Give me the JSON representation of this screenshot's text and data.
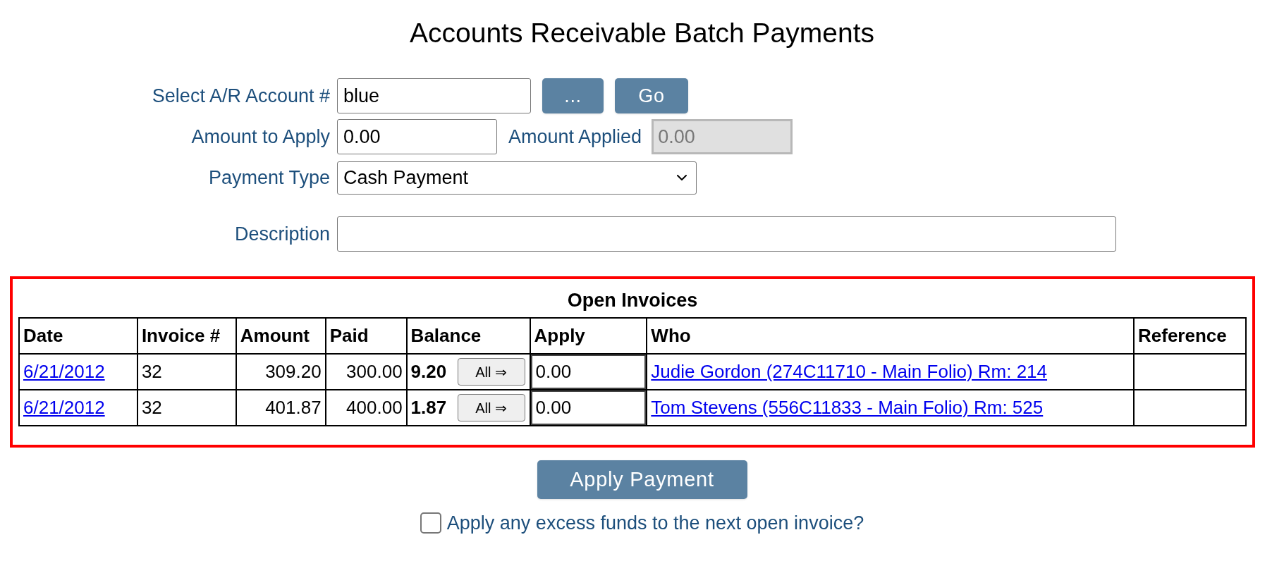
{
  "title": "Accounts Receivable Batch Payments",
  "account": {
    "label": "Select A/R Account #",
    "value": "blue",
    "buttons": [
      "...",
      "Go"
    ]
  },
  "amount_to_apply": {
    "label": "Amount to Apply",
    "value": "0.00"
  },
  "amount_applied": {
    "label": "Amount Applied",
    "value": "0.00",
    "disabled": true
  },
  "payment_type": {
    "label": "Payment Type",
    "value": "Cash Payment"
  },
  "description": {
    "label": "Description"
  },
  "open_invoices": {
    "title": "Open Invoices",
    "columns": [
      "Date",
      "Invoice #",
      "Amount",
      "Paid",
      "Balance",
      "Apply",
      "Who",
      "Reference"
    ],
    "rows": [
      {
        "date": "6/21/2012",
        "invoice": "32",
        "amount": "309.20",
        "paid": "300.00",
        "balance": "9.20",
        "all_button": "All ⇒",
        "apply": "0.00",
        "who": "Judie Gordon (274C11710 - Main Folio) Rm: 214"
      },
      {
        "date": "6/21/2012",
        "invoice": "32",
        "amount": "401.87",
        "paid": "400.00",
        "balance": "1.87",
        "all_button": "All ⇒",
        "apply": "0.00",
        "who": "Tom Stevens (556C11833 - Main Folio) Rm: 525"
      }
    ]
  },
  "apply_button": "Apply Payment",
  "excess_funds": {
    "label": "Apply any excess funds to the next open invoice?",
    "checked": false
  }
}
